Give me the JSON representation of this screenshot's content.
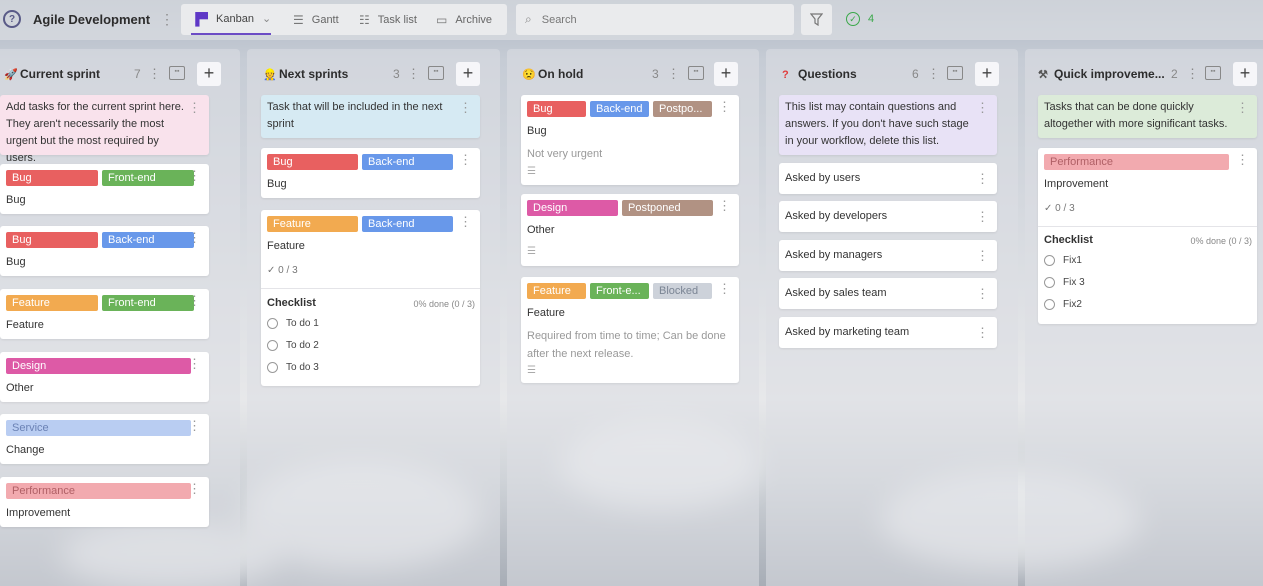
{
  "header": {
    "project_title": "Agile Development",
    "views": [
      {
        "label": "Kanban",
        "icon": "kanban-icon",
        "active": true
      },
      {
        "label": "Gantt",
        "icon": "gantt-icon"
      },
      {
        "label": "Task list",
        "icon": "list-icon"
      },
      {
        "label": "Archive",
        "icon": "archive-icon"
      }
    ],
    "search_placeholder": "Search",
    "completed_count": "4"
  },
  "colors": {
    "bug": "#e86060",
    "backend": "#6898ea",
    "frontend": "#6ab359",
    "feature": "#f2aa50",
    "design": "#dd5aa6",
    "service": "#b9cdf2",
    "performance": "#f2aaaf",
    "postponed": "#b19283",
    "blocked": "#cdd2da",
    "accent": "#6c4cc5"
  },
  "columns": [
    {
      "title": "Current sprint",
      "icon": "rocket-icon",
      "count": "7",
      "note": "Add tasks for the current sprint here. They aren't necessarily the most urgent but the most required by users.",
      "cards": [
        {
          "tags": [
            "Bug",
            "Front-end"
          ],
          "title": "Bug"
        },
        {
          "tags": [
            "Bug",
            "Back-end"
          ],
          "title": "Bug"
        },
        {
          "tags": [
            "Feature",
            "Front-end"
          ],
          "title": "Feature"
        },
        {
          "tags": [
            "Design"
          ],
          "title": "Other"
        },
        {
          "tags": [
            "Service"
          ],
          "title": "Change"
        },
        {
          "tags": [
            "Performance"
          ],
          "title": "Improvement"
        }
      ]
    },
    {
      "title": "Next sprints",
      "icon": "person-icon",
      "count": "3",
      "note": "Task that will be included in the next sprint",
      "cards": [
        {
          "tags": [
            "Bug",
            "Back-end"
          ],
          "title": "Bug"
        },
        {
          "tags": [
            "Feature",
            "Back-end"
          ],
          "title": "Feature",
          "checklist_count": "0 / 3",
          "checklist": {
            "title": "Checklist",
            "progress": "0% done (0 / 3)",
            "items": [
              "To do 1",
              "To do 2",
              "To do 3"
            ]
          }
        }
      ]
    },
    {
      "title": "On hold",
      "icon": "face-icon",
      "count": "3",
      "cards": [
        {
          "tags": [
            "Bug",
            "Back-end",
            "Postpo..."
          ],
          "title": "Bug",
          "description": "Not very urgent"
        },
        {
          "tags": [
            "Design",
            "Postponed"
          ],
          "title": "Other"
        },
        {
          "tags": [
            "Feature",
            "Front-e...",
            "Blocked"
          ],
          "title": "Feature",
          "description": "Required from time to time; Can be done after the next release."
        }
      ]
    },
    {
      "title": "Questions",
      "icon": "question-icon",
      "count": "6",
      "note": "This list may contain questions and answers. If you don't have such stage in your workflow, delete this list.",
      "cards": [
        {
          "title": "Asked by users"
        },
        {
          "title": "Asked by developers"
        },
        {
          "title": "Asked by managers"
        },
        {
          "title": "Asked by sales team"
        },
        {
          "title": "Asked by marketing team"
        }
      ]
    },
    {
      "title": "Quick improveme...",
      "icon": "tools-icon",
      "count": "2",
      "note": "Tasks that can be done quickly altogether with more significant tasks.",
      "cards": [
        {
          "tags": [
            "Performance"
          ],
          "title": "Improvement",
          "checklist_count": "0 / 3",
          "checklist": {
            "title": "Checklist",
            "progress": "0% done (0 / 3)",
            "items": [
              "Fix1",
              "Fix 3",
              "Fix2"
            ]
          }
        }
      ]
    }
  ]
}
